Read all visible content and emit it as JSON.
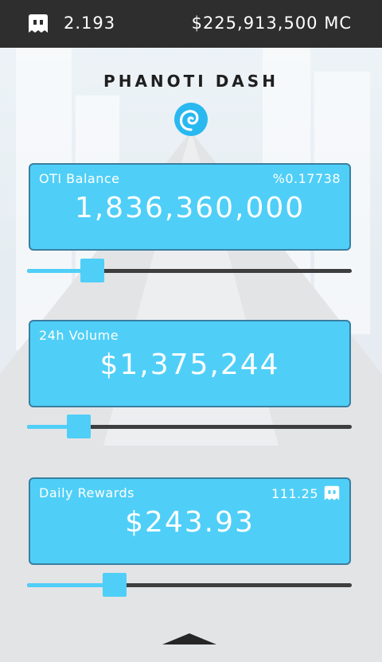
{
  "topbar": {
    "multiplier": "2.193",
    "mc_balance": "$225,913,500 MC",
    "ghost_icon": "ghost-icon"
  },
  "title": "PHANOTI DASH",
  "logo_icon": "swirl-logo",
  "colors": {
    "accent": "#4fcff7",
    "card_border": "#3a7ea1",
    "topbar": "#2e2e2e",
    "track": "#3e3e3e"
  },
  "cards": [
    {
      "label": "OTI Balance",
      "extra": "%0.17738",
      "value": "1,836,360,000",
      "slider_fraction": 0.2
    },
    {
      "label": "24h Volume",
      "extra": "",
      "value": "$1,375,244",
      "slider_fraction": 0.16
    },
    {
      "label": "Daily Rewards",
      "extra": "111.25",
      "value": "$243.93",
      "slider_fraction": 0.27
    }
  ],
  "bottom_icon": "chevron-up-icon"
}
